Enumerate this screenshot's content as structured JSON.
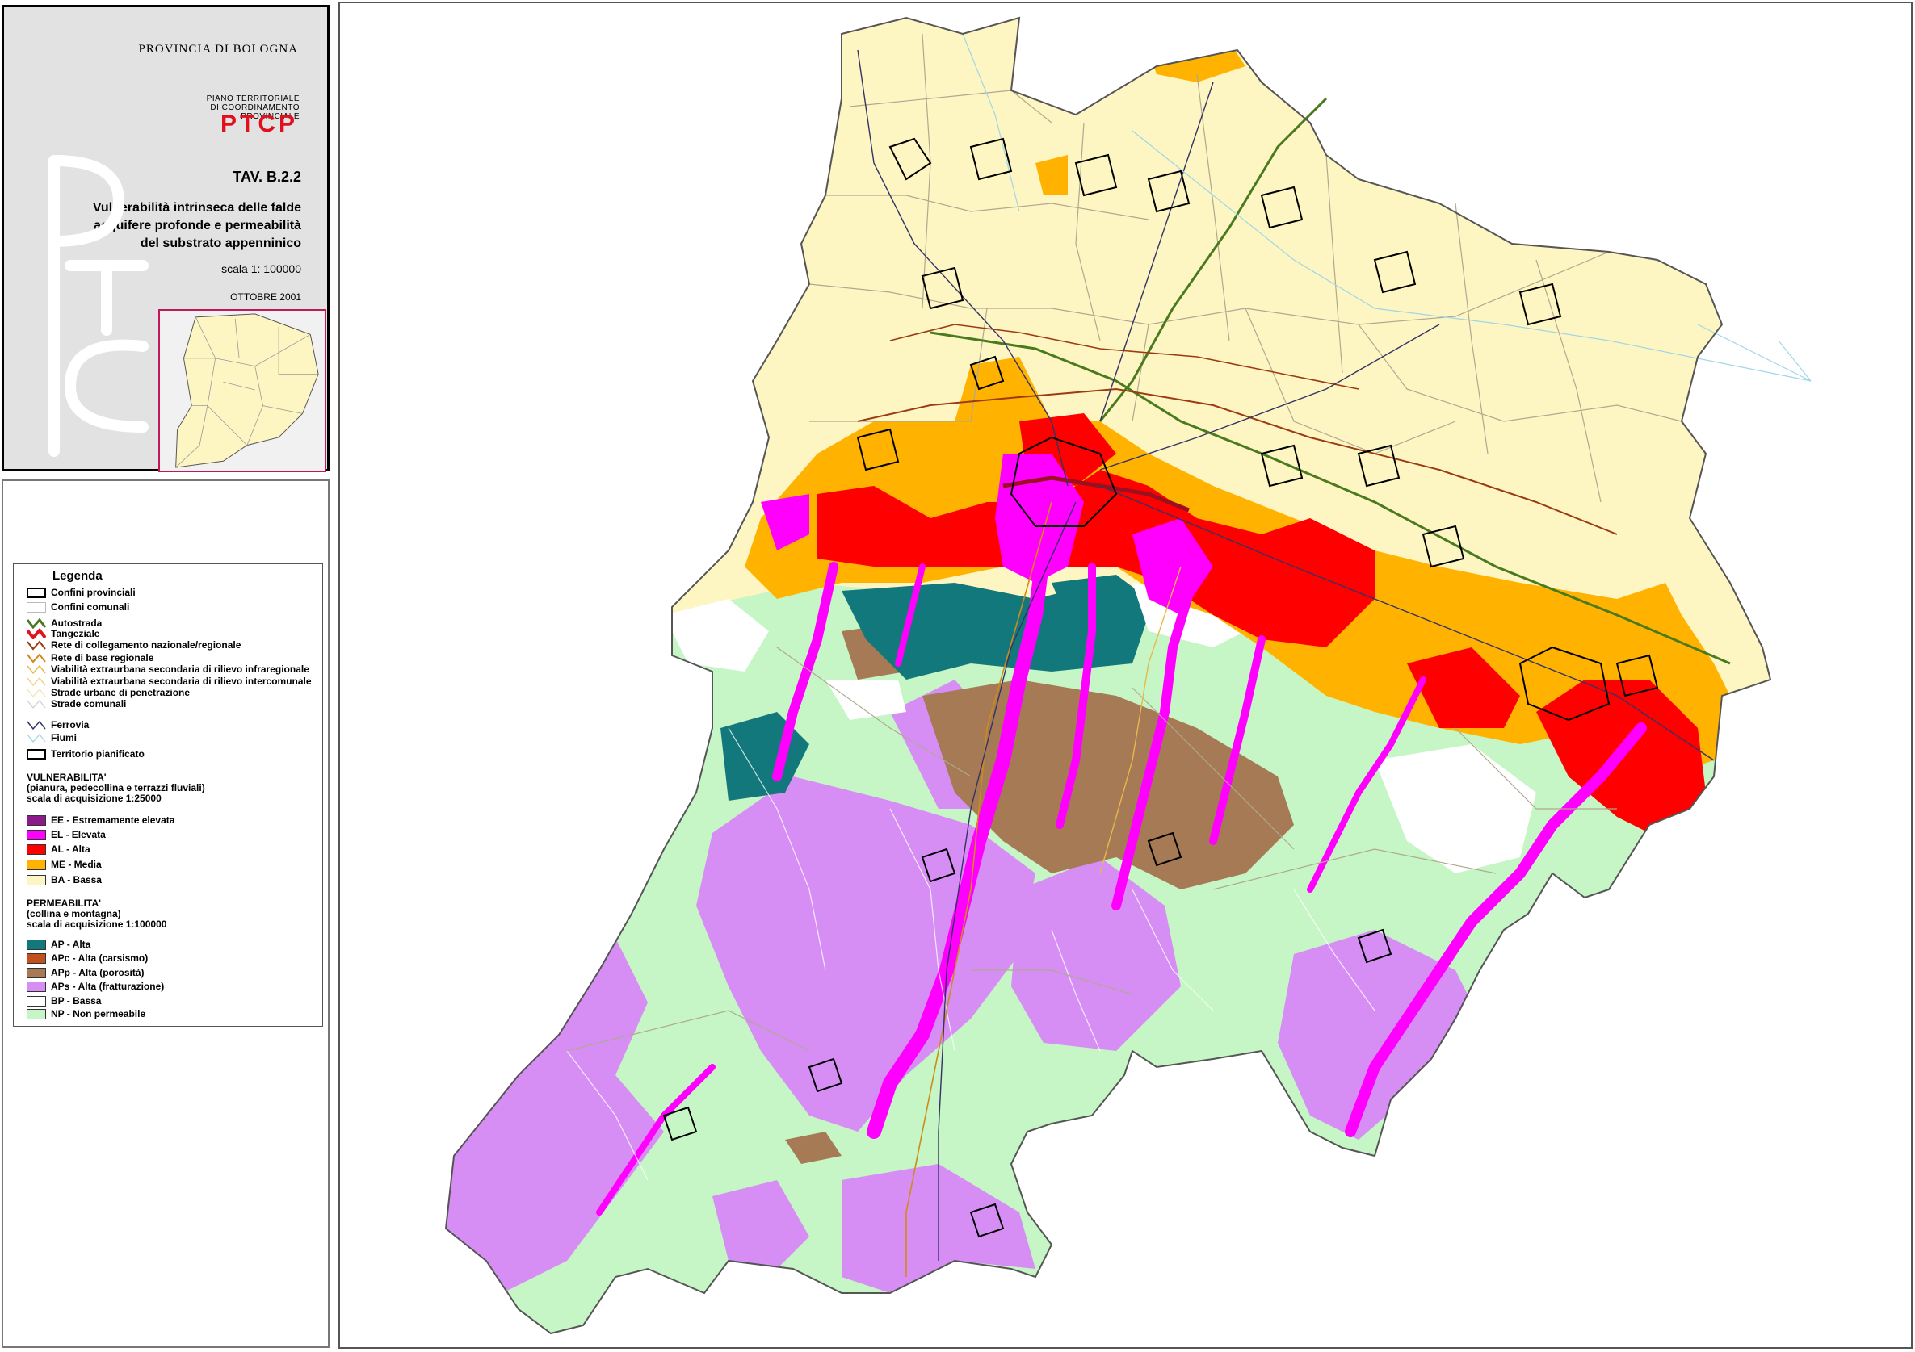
{
  "header": {
    "province": "PROVINCIA DI BOLOGNA",
    "plan_line1": "PIANO TERRITORIALE",
    "plan_line2": "DI COORDINAMENTO",
    "plan_line3": "PROVINCIALE",
    "logo_text": "PTCP",
    "table_number": "TAV. B.2.2",
    "subtitle_line1": "Vulnerabilità intrinseca delle falde",
    "subtitle_line2": "acquifere profonde e permeabilità",
    "subtitle_line3": "del  substrato appenninico",
    "scale": "scala 1: 100000",
    "date": "OTTOBRE 2001"
  },
  "legend": {
    "title": "Legenda",
    "lines": [
      {
        "label": "Confini provinciali",
        "kind": "box",
        "color": "#000000"
      },
      {
        "label": "Confini comunali",
        "kind": "box",
        "color": "#bbbbbb"
      },
      {
        "label": "Autostrada",
        "kind": "line",
        "color": "#4a7a1e"
      },
      {
        "label": "Tangeziale",
        "kind": "line",
        "color": "#e0141e"
      },
      {
        "label": "Rete di collegamento nazionale/regionale",
        "kind": "line",
        "color": "#9b3b12"
      },
      {
        "label": "Rete di base regionale",
        "kind": "line",
        "color": "#d08a1a"
      },
      {
        "label": "Viabilità extraurbana secondaria di rilievo infraregionale",
        "kind": "line",
        "color": "#e8b84a"
      },
      {
        "label": "Viabilità extraurbana secondaria di rilievo intercomunale",
        "kind": "line",
        "color": "#f0d48a"
      },
      {
        "label": "Strade urbane di penetrazione",
        "kind": "line",
        "color": "#f3e2b0"
      },
      {
        "label": "Strade comunali",
        "kind": "line",
        "color": "#dcdcdc"
      }
    ],
    "network": [
      {
        "label": "Ferrovia",
        "kind": "line",
        "color": "#333366"
      },
      {
        "label": "Fiumi",
        "kind": "line",
        "color": "#9fd7e8"
      },
      {
        "label": "Territorio pianificato",
        "kind": "box",
        "color": "#000000"
      }
    ],
    "vulnerability_title": "VULNERABILITA'",
    "vulnerability_sub1": "(pianura, pedecollina e terrazzi fluviali)",
    "vulnerability_sub2": "scala di acquisizione 1:25000",
    "vulnerability": [
      {
        "label": "EE - Estremamente elevata",
        "color": "#8b1a8b"
      },
      {
        "label": "EL - Elevata",
        "color": "#ff00ff"
      },
      {
        "label": "AL - Alta",
        "color": "#ff0000"
      },
      {
        "label": "ME - Media",
        "color": "#ffb300"
      },
      {
        "label": "BA - Bassa",
        "color": "#fdf5c2"
      }
    ],
    "permeability_title": "PERMEABILITA'",
    "permeability_sub1": "(collina e montagna)",
    "permeability_sub2": "scala di acquisizione 1:100000",
    "permeability": [
      {
        "label": "AP - Alta",
        "color": "#13787c"
      },
      {
        "label": "APc - Alta (carsismo)",
        "color": "#c2501c"
      },
      {
        "label": "APp - Alta (porosità)",
        "color": "#a57a55"
      },
      {
        "label": "APs - Alta (fratturazione)",
        "color": "#d68ef5"
      },
      {
        "label": "BP - Bassa",
        "color": "#ffffff"
      },
      {
        "label": "NP - Non permeabile",
        "color": "#c6f5c6"
      }
    ]
  }
}
